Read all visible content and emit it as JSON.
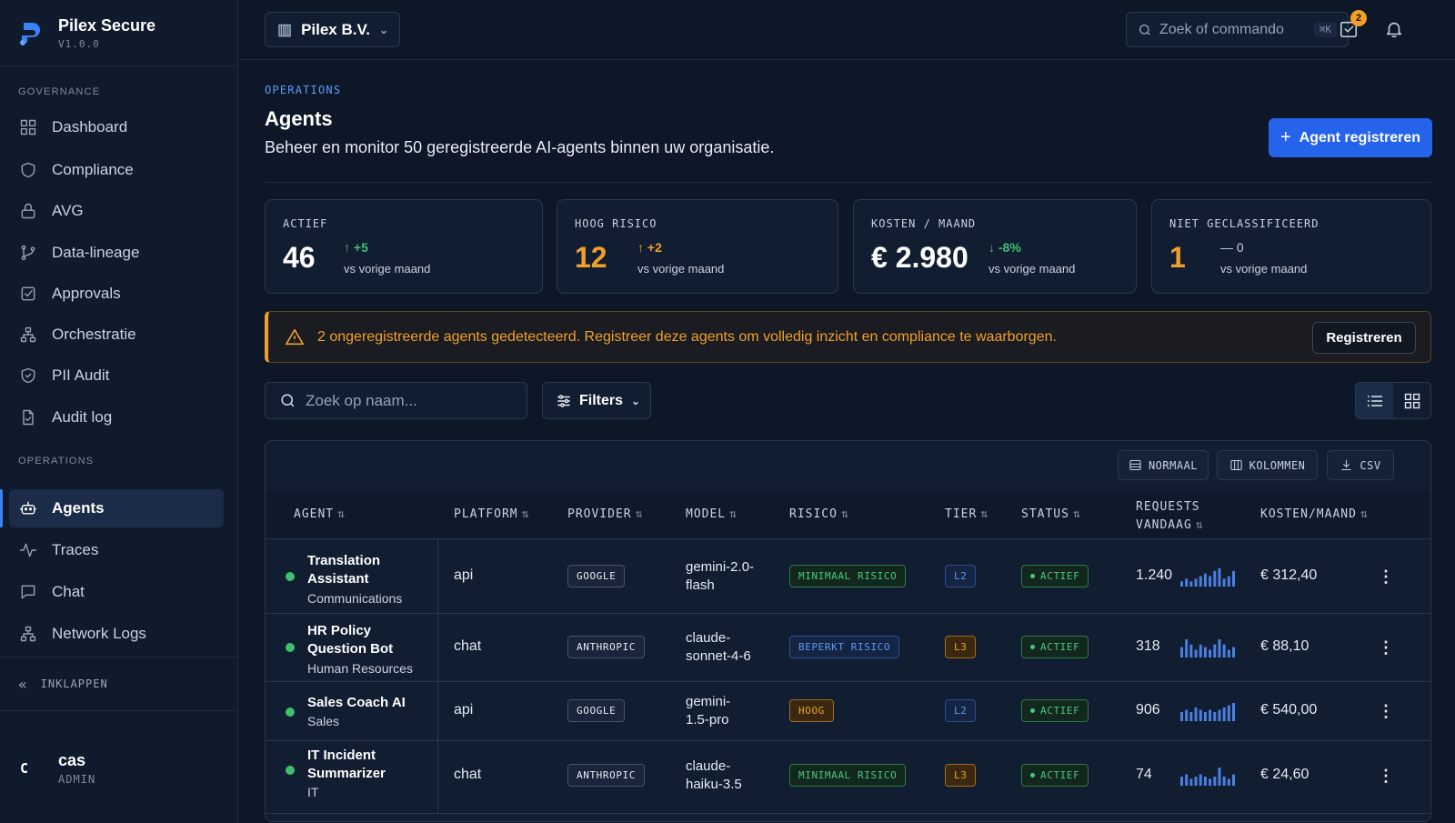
{
  "brand": {
    "name": "Pilex Secure",
    "version": "V1.0.0"
  },
  "sidebar": {
    "sections": [
      "GOVERNANCE",
      "OPERATIONS"
    ],
    "governance_items": [
      {
        "label": "Dashboard",
        "icon": "grid-icon"
      },
      {
        "label": "Compliance",
        "icon": "shield-icon"
      },
      {
        "label": "AVG",
        "icon": "lock-icon"
      },
      {
        "label": "Data-lineage",
        "icon": "branch-icon"
      },
      {
        "label": "Approvals",
        "icon": "checkbox-icon"
      },
      {
        "label": "Orchestratie",
        "icon": "network-icon"
      },
      {
        "label": "PII Audit",
        "icon": "shield-check-icon"
      },
      {
        "label": "Audit log",
        "icon": "file-icon"
      }
    ],
    "operations_items": [
      {
        "label": "Agents",
        "icon": "bot-icon",
        "active": true
      },
      {
        "label": "Traces",
        "icon": "activity-icon"
      },
      {
        "label": "Chat",
        "icon": "chat-icon"
      },
      {
        "label": "Network Logs",
        "icon": "network-icon"
      }
    ],
    "collapse_label": "INKLAPPEN",
    "user": {
      "initial": "C",
      "name": "cas",
      "role": "ADMIN"
    }
  },
  "topbar": {
    "org": "Pilex B.V.",
    "search_placeholder": "Zoek of commando",
    "shortcut": "⌘K",
    "tasks_badge": "2"
  },
  "header": {
    "section": "OPERATIONS",
    "title": "Agents",
    "subtitle": "Beheer en monitor 50 geregistreerde AI-agents binnen uw organisatie.",
    "primary_button": "Agent registreren"
  },
  "stats": [
    {
      "label": "ACTIEF",
      "value": "46",
      "delta": "+5",
      "vs": "vs vorige maand"
    },
    {
      "label": "HOOG RISICO",
      "value": "12",
      "delta": "+2",
      "vs": "vs vorige maand"
    },
    {
      "label": "KOSTEN / MAAND",
      "value": "€ 2.980",
      "delta": "-8%",
      "vs": "vs vorige maand"
    },
    {
      "label": "NIET GECLASSIFICEERD",
      "value": "1",
      "delta": "0",
      "vs": "vs vorige maand"
    }
  ],
  "alert": {
    "text": "2 ongeregistreerde agents gedetecteerd. Registreer deze agents om volledig inzicht en compliance te waarborgen.",
    "button": "Registreren"
  },
  "toolbar": {
    "search_placeholder": "Zoek op naam...",
    "filters": "Filters",
    "density": "NORMAAL",
    "columns": "KOLOMMEN",
    "export": "CSV"
  },
  "table": {
    "headers": {
      "agent": "AGENT",
      "platform": "PLATFORM",
      "provider": "PROVIDER",
      "model": "MODEL",
      "risico": "RISICO",
      "tier": "TIER",
      "status": "STATUS",
      "requests_1": "REQUESTS",
      "requests_2": "VANDAAG",
      "kosten": "KOSTEN/MAAND"
    },
    "rows": [
      {
        "name": "Translation Assistant",
        "dept": "Communications",
        "platform": "api",
        "provider": "GOOGLE",
        "model": "gemini-2.0-flash",
        "risk": "MINIMAAL RISICO",
        "tier": "L2",
        "status": "ACTIEF",
        "requests": "1.240",
        "cost": "€ 312,40",
        "spark": [
          2,
          3,
          2,
          3,
          4,
          5,
          4,
          6,
          7,
          3,
          4,
          6
        ]
      },
      {
        "name": "HR Policy Question Bot",
        "dept": "Human Resources",
        "platform": "chat",
        "provider": "ANTHROPIC",
        "model": "claude-sonnet-4-6",
        "risk": "BEPERKT RISICO",
        "tier": "L3",
        "status": "ACTIEF",
        "requests": "318",
        "cost": "€ 88,10",
        "spark": [
          4,
          7,
          5,
          3,
          5,
          4,
          3,
          5,
          7,
          5,
          3,
          4
        ]
      },
      {
        "name": "Sales Coach AI",
        "dept": "Sales",
        "platform": "api",
        "provider": "GOOGLE",
        "model": "gemini-1.5-pro",
        "risk": "HOOG",
        "tier": "L2",
        "status": "ACTIEF",
        "requests": "906",
        "cost": "€ 540,00",
        "spark": [
          4,
          5,
          4,
          6,
          5,
          4,
          5,
          4,
          5,
          6,
          7,
          8
        ]
      },
      {
        "name": "IT Incident Summarizer",
        "dept": "IT",
        "platform": "chat",
        "provider": "ANTHROPIC",
        "model": "claude-haiku-3.5",
        "risk": "MINIMAAL RISICO",
        "tier": "L3",
        "status": "ACTIEF",
        "requests": "74",
        "cost": "€ 24,60",
        "spark": [
          4,
          5,
          3,
          4,
          5,
          4,
          3,
          4,
          8,
          4,
          3,
          5
        ]
      }
    ]
  }
}
